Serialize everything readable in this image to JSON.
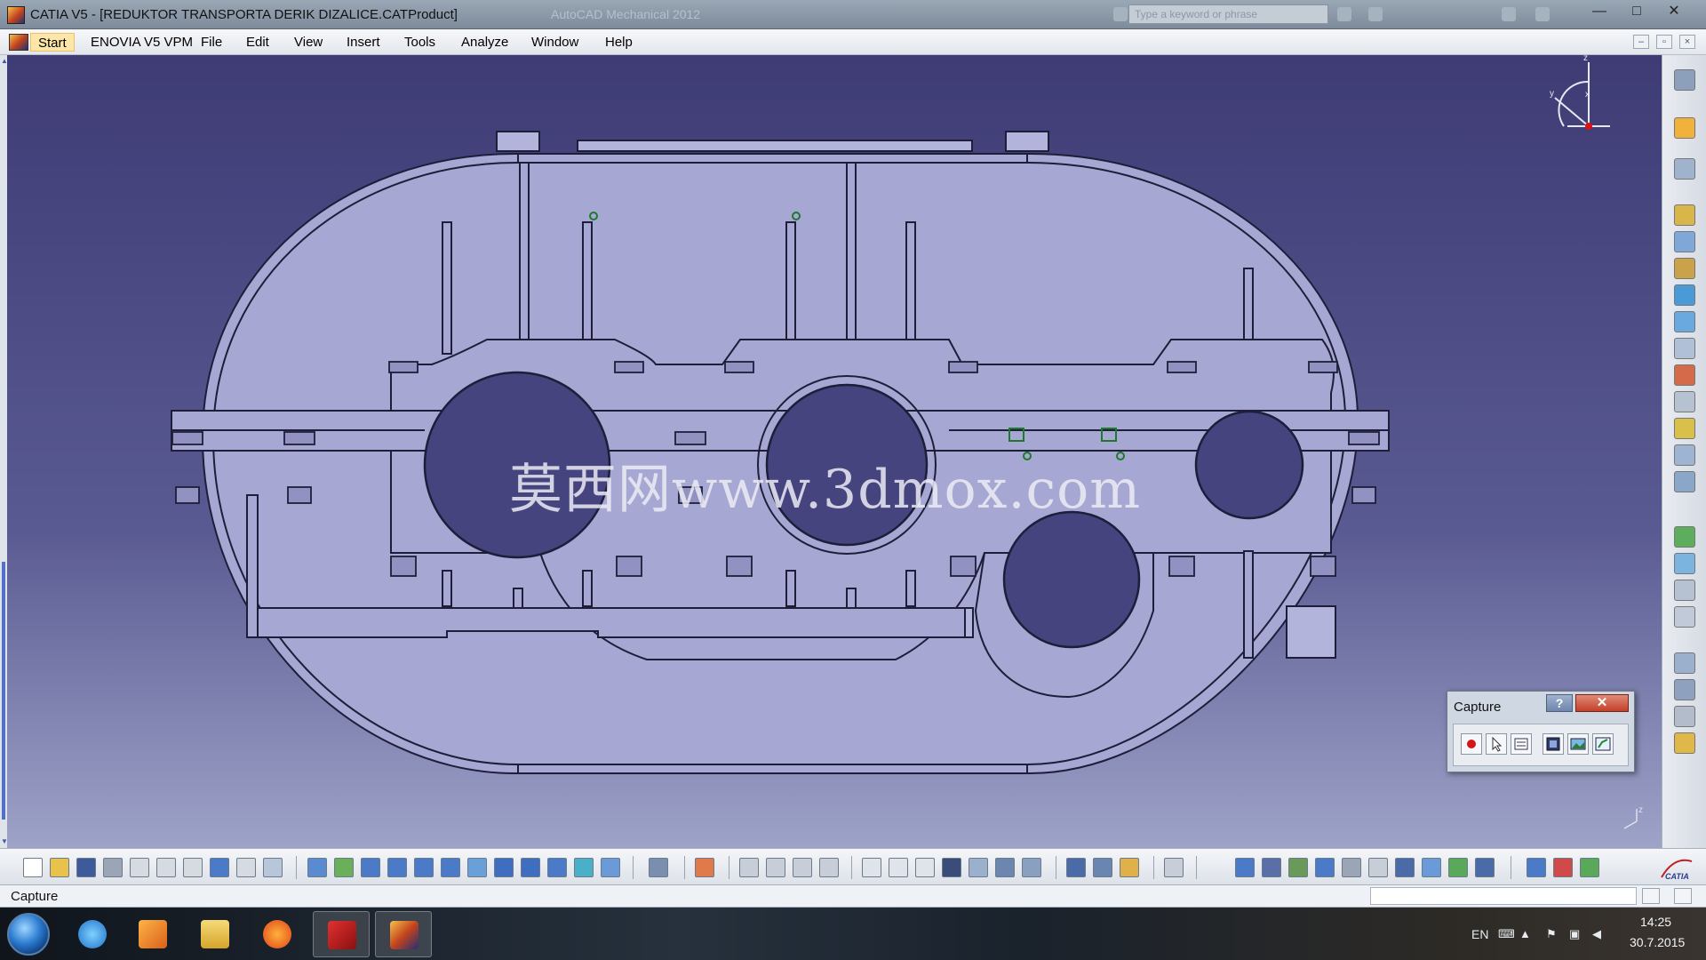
{
  "window": {
    "title": "CATIA V5 - [REDUKTOR TRANSPORTA DERIK DIZALICE.CATProduct]",
    "ghost_title": "AutoCAD Mechanical 2012",
    "info_search_placeholder": "Type a keyword or phrase",
    "minimize": "—",
    "maximize": "□",
    "close": "✕"
  },
  "menubar": {
    "items": [
      "Start",
      "ENOVIA V5 VPM",
      "File",
      "Edit",
      "View",
      "Insert",
      "Tools",
      "Analyze",
      "Window",
      "Help"
    ],
    "mdi_minimize": "–",
    "mdi_restore": "▫",
    "mdi_close": "×"
  },
  "viewport": {
    "watermark": "莫西网www.3dmox.com",
    "compass_labels": {
      "z": "z",
      "y": "y",
      "x": "x"
    },
    "axis_label": "z"
  },
  "capture_dialog": {
    "title": "Capture",
    "help_label": "?",
    "close_label": "✕",
    "tools": [
      "record-icon",
      "select-icon",
      "options-icon",
      "capture-icon",
      "image-album-icon",
      "capture-settings-icon"
    ]
  },
  "statusbar": {
    "text": "Capture"
  },
  "taskbar": {
    "apps": [
      "internet-explorer-icon",
      "media-player-icon",
      "file-explorer-icon",
      "firefox-icon",
      "autocad-icon",
      "catia-icon"
    ],
    "language": "EN",
    "time": "14:25",
    "date": "30.7.2015"
  },
  "colors": {
    "viewport_top": "#3e3b75",
    "viewport_bottom": "#9ea3c8",
    "part_fill": "#a6a7d2",
    "part_stroke": "#1e1e3a",
    "hole_fill": "#46447e"
  }
}
